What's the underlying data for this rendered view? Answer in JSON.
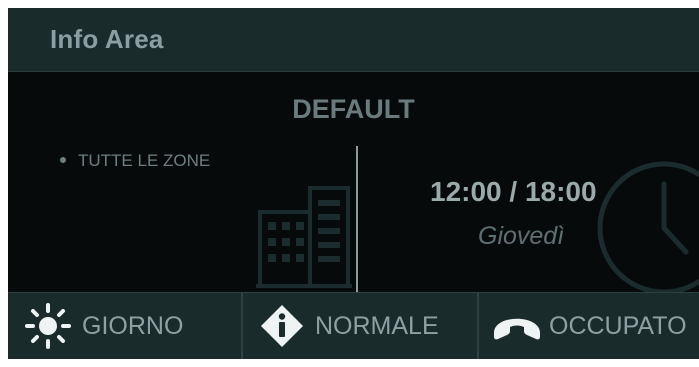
{
  "header": {
    "title": "Info Area"
  },
  "profile": {
    "name": "DEFAULT"
  },
  "zones": {
    "items": [
      "TUTTE LE ZONE"
    ]
  },
  "schedule": {
    "time": "12:00 / 18:00",
    "day": "Giovedì"
  },
  "status_bar": {
    "items": [
      {
        "label": "GIORNO",
        "icon": "sun-icon"
      },
      {
        "label": "NORMALE",
        "icon": "info-diamond-icon"
      },
      {
        "label": "OCCUPATO",
        "icon": "phone-handset-icon"
      }
    ]
  },
  "colors": {
    "panel_bg": "#060a0b",
    "bar_bg": "#1a2b2c",
    "text_light": "#8ea1a2",
    "text_dim": "#697b7d",
    "icon_white": "#eef3f3"
  }
}
